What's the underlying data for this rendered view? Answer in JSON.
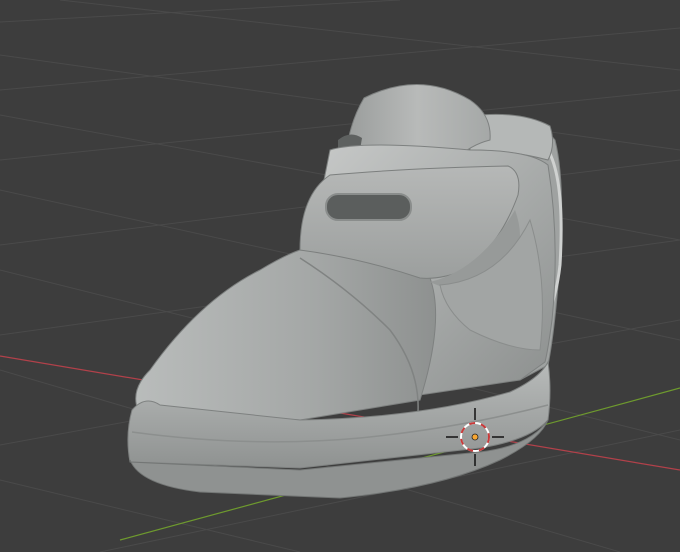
{
  "viewport": {
    "background": "#3d3d3d",
    "grid_color": "#4a4a4a",
    "x_axis_color": "#b2414a",
    "y_axis_color": "#6e9a2e"
  },
  "object": {
    "kind": "shoe-mesh",
    "shading": "solid",
    "base_color": "#a7aaa9"
  },
  "cursor_3d": {
    "icon": "3d-cursor-icon",
    "ring_colors": [
      "#c83a3a",
      "#ffffff"
    ]
  },
  "origin_point": {
    "color": "#f7a632"
  }
}
